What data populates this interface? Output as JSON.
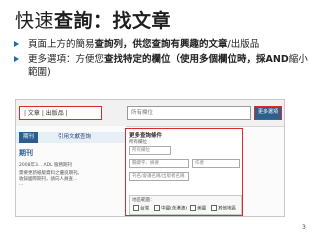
{
  "slide": {
    "title_part1": "快速",
    "title_part2": "查詢：找文章",
    "bullets": [
      {
        "pre": "頁面上方的簡易",
        "bold": "查詢列，供您查詢有興趣的文章",
        "post": "/出版品"
      },
      {
        "pre": "更多選項：方便您",
        "bold": "查找特定的欄位（使用多個欄位時，採AND",
        "post": "縮小範圍)"
      }
    ],
    "page_number": "3"
  },
  "screenshot": {
    "tabs_label": "|  文章  |  出版品  |",
    "search_placeholder": "所有欄位",
    "more_button": "更多選項",
    "nav_left": "期刊",
    "nav_mid": "引用文獻查詢",
    "section_heading": "期刊",
    "side_lines": [
      "2008年3... ADL 服務期刊",
      "需要更新紙版資料之優良期刊。",
      "收錄國際期刊，請向人員查...",
      "..."
    ],
    "panel_title": "更多查詢條件",
    "panel_sub": "所有欄位",
    "field_keyword": "關鍵字、摘要",
    "field_author": "作者",
    "field_pub": "刊名/會議名稱/出版者名稱",
    "region_label": "地區範圍：",
    "regions": [
      "台灣",
      "中國(含港澳)",
      "美國",
      "其他地區"
    ]
  }
}
